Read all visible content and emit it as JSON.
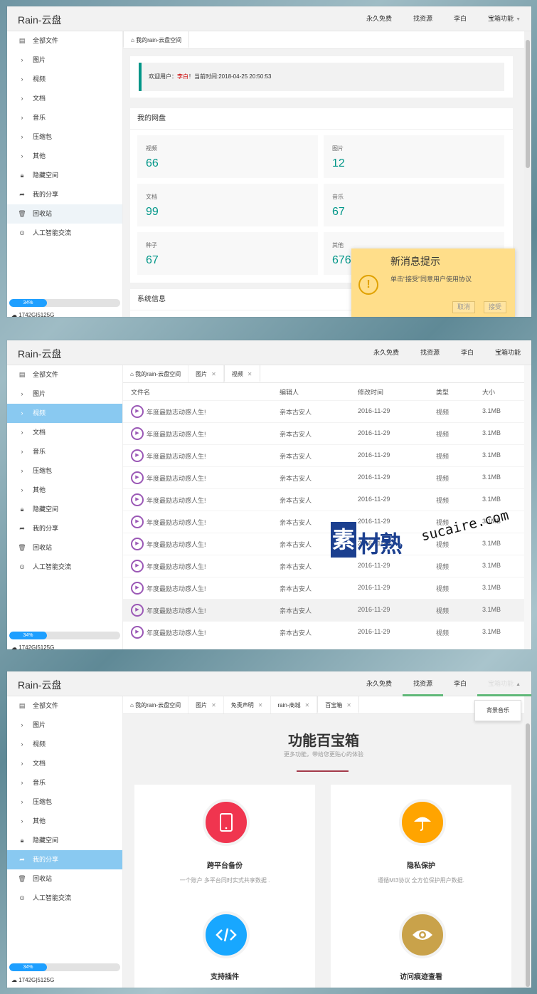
{
  "app": {
    "title": "Rain-云盘"
  },
  "topnav": [
    {
      "label": "永久免费"
    },
    {
      "label": "找资源"
    },
    {
      "label": "李白"
    },
    {
      "label": "宝箱功能"
    }
  ],
  "sidebar": {
    "items": [
      {
        "label": "全部文件",
        "icon": "file-icon"
      },
      {
        "label": "图片",
        "icon": "chevron-right-icon"
      },
      {
        "label": "视频",
        "icon": "chevron-right-icon"
      },
      {
        "label": "文档",
        "icon": "chevron-right-icon"
      },
      {
        "label": "音乐",
        "icon": "chevron-right-icon"
      },
      {
        "label": "压缩包",
        "icon": "chevron-right-icon"
      },
      {
        "label": "其他",
        "icon": "chevron-right-icon"
      },
      {
        "label": "隐藏空间",
        "icon": "lock-icon"
      },
      {
        "label": "我的分享",
        "icon": "share-icon"
      },
      {
        "label": "回收站",
        "icon": "trash-icon"
      },
      {
        "label": "人工智能交流",
        "icon": "chat-icon"
      }
    ],
    "usage_percent": 34,
    "usage_label": "34%",
    "storage": "1742G|5125G"
  },
  "screen1": {
    "tabs": [
      {
        "label": "我的rain-云盘空间"
      }
    ],
    "welcome": {
      "prefix": "欢迎用户：",
      "user": "李白",
      "suffix": "！当前时间:2018-04-25 20:50:53"
    },
    "disk_title": "我的网盘",
    "stats": [
      {
        "label": "视频",
        "value": "66"
      },
      {
        "label": "图片",
        "value": "12"
      },
      {
        "label": "文档",
        "value": "99"
      },
      {
        "label": "音乐",
        "value": "67"
      },
      {
        "label": "种子",
        "value": "67"
      },
      {
        "label": "其他",
        "value": "676"
      }
    ],
    "sys_title": "系统信息",
    "popup": {
      "title": "新消息提示",
      "text": "单击“接受”同意用户使用协议",
      "cancel": "取消",
      "accept": "接受"
    }
  },
  "screen2": {
    "tabs": [
      {
        "label": "我的rain-云盘空间"
      },
      {
        "label": "图片"
      },
      {
        "label": "视频"
      }
    ],
    "columns": [
      "文件名",
      "编辑人",
      "修改时间",
      "类型",
      "大小"
    ],
    "rows": [
      {
        "name": "年度最励志动感人生!",
        "editor": "亲本古安人",
        "date": "2016-11-29",
        "type": "视频",
        "size": "3.1MB"
      },
      {
        "name": "年度最励志动感人生!",
        "editor": "亲本古安人",
        "date": "2016-11-29",
        "type": "视频",
        "size": "3.1MB"
      },
      {
        "name": "年度最励志动感人生!",
        "editor": "亲本古安人",
        "date": "2016-11-29",
        "type": "视频",
        "size": "3.1MB"
      },
      {
        "name": "年度最励志动感人生!",
        "editor": "亲本古安人",
        "date": "2016-11-29",
        "type": "视频",
        "size": "3.1MB"
      },
      {
        "name": "年度最励志动感人生!",
        "editor": "亲本古安人",
        "date": "2016-11-29",
        "type": "视频",
        "size": "3.1MB"
      },
      {
        "name": "年度最励志动感人生!",
        "editor": "亲本古安人",
        "date": "2016-11-29",
        "type": "视频",
        "size": "3.1MB"
      },
      {
        "name": "年度最励志动感人生!",
        "editor": "亲本古安人",
        "date": "2016-11-29",
        "type": "视频",
        "size": "3.1MB"
      },
      {
        "name": "年度最励志动感人生!",
        "editor": "亲本古安人",
        "date": "2016-11-29",
        "type": "视频",
        "size": "3.1MB"
      },
      {
        "name": "年度最励志动感人生!",
        "editor": "亲本古安人",
        "date": "2016-11-29",
        "type": "视频",
        "size": "3.1MB"
      },
      {
        "name": "年度最励志动感人生!",
        "editor": "亲本古安人",
        "date": "2016-11-29",
        "type": "视频",
        "size": "3.1MB"
      },
      {
        "name": "年度最励志动感人生!",
        "editor": "亲本古安人",
        "date": "2016-11-29",
        "type": "视频",
        "size": "3.1MB"
      }
    ],
    "watermark": {
      "block": "素",
      "text": "材熟",
      "url": "sucaire.com"
    }
  },
  "screen3": {
    "tabs": [
      {
        "label": "我的rain-云盘空间"
      },
      {
        "label": "图片"
      },
      {
        "label": "免责声明"
      },
      {
        "label": "rain-商城"
      },
      {
        "label": "百宝箱"
      }
    ],
    "dropdown": "背景音乐",
    "hero_title": "功能百宝箱",
    "hero_sub": "更多功能，带给您更贴心的体验",
    "features": [
      {
        "title": "跨平台备份",
        "desc": "一个账户  多平台同时实式共享数据  .",
        "icon": "tablet-icon",
        "color": "#f0354f"
      },
      {
        "title": "隐私保护",
        "desc": "遵循MI3协议  全方位保护用户数据.",
        "icon": "umbrella-icon",
        "color": "#ffa400"
      },
      {
        "title": "支持插件",
        "desc": "",
        "icon": "code-icon",
        "color": "#18a7ff"
      },
      {
        "title": "访问痕迹查看",
        "desc": "",
        "icon": "eye-icon",
        "color": "#c9a24a"
      }
    ]
  }
}
